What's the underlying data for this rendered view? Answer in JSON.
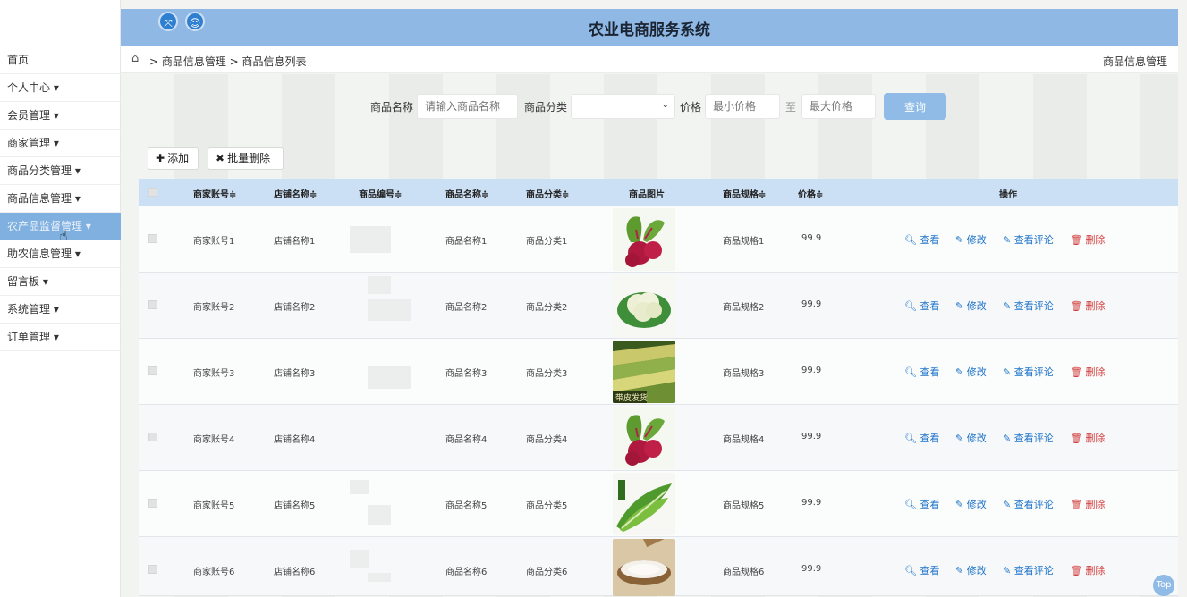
{
  "header": {
    "title": "农业电商服务系统",
    "icons": [
      "expand-icon",
      "user-icon"
    ]
  },
  "sidebar": {
    "items": [
      {
        "label": "首页"
      },
      {
        "label": "个人中心 ▾"
      },
      {
        "label": "会员管理 ▾"
      },
      {
        "label": "商家管理 ▾"
      },
      {
        "label": "商品分类管理 ▾"
      },
      {
        "label": "商品信息管理 ▾"
      },
      {
        "label": "农产品监督管理 ▾"
      },
      {
        "label": "助农信息管理 ▾"
      },
      {
        "label": "留言板 ▾"
      },
      {
        "label": "系统管理 ▾"
      },
      {
        "label": "订单管理 ▾"
      }
    ]
  },
  "breadcrumb": {
    "path": "> 商品信息管理 > 商品信息列表",
    "right": "商品信息管理"
  },
  "search": {
    "name_label": "商品名称",
    "name_placeholder": "请输入商品名称",
    "category_label": "商品分类",
    "price_label": "价格",
    "min_placeholder": "最小价格",
    "to_label": "至",
    "max_placeholder": "最大价格",
    "query_button": "查询"
  },
  "toolbar": {
    "add_label": "添加",
    "batch_delete_label": "批量删除"
  },
  "table": {
    "headers": [
      "商家账号≑",
      "店铺名称≑",
      "商品编号≑",
      "商品名称≑",
      "商品分类≑",
      "商品图片",
      "商品规格≑",
      "价格≑",
      "操作"
    ],
    "rows": [
      {
        "account": "商家账号1",
        "shop": "店铺名称1",
        "name": "商品名称1",
        "category": "商品分类1",
        "spec": "商品规格1",
        "price": "99.9",
        "image": "beetroot"
      },
      {
        "account": "商家账号2",
        "shop": "店铺名称2",
        "name": "商品名称2",
        "category": "商品分类2",
        "spec": "商品规格2",
        "price": "99.9",
        "image": "cauliflower"
      },
      {
        "account": "商家账号3",
        "shop": "店铺名称3",
        "name": "商品名称3",
        "category": "商品分类3",
        "spec": "商品规格3",
        "price": "99.9",
        "image": "corn",
        "image_caption": "带皮发货"
      },
      {
        "account": "商家账号4",
        "shop": "店铺名称4",
        "name": "商品名称4",
        "category": "商品分类4",
        "spec": "商品规格4",
        "price": "99.9",
        "image": "beetroot"
      },
      {
        "account": "商家账号5",
        "shop": "店铺名称5",
        "name": "商品名称5",
        "category": "商品分类5",
        "spec": "商品规格5",
        "price": "99.9",
        "image": "lettuce"
      },
      {
        "account": "商家账号6",
        "shop": "店铺名称6",
        "name": "商品名称6",
        "category": "商品分类6",
        "spec": "商品规格6",
        "price": "99.9",
        "image": "rice"
      }
    ],
    "ops": {
      "view": "查看",
      "edit": "修改",
      "comments": "查看评论",
      "delete": "删除"
    }
  },
  "top_button": "Top"
}
